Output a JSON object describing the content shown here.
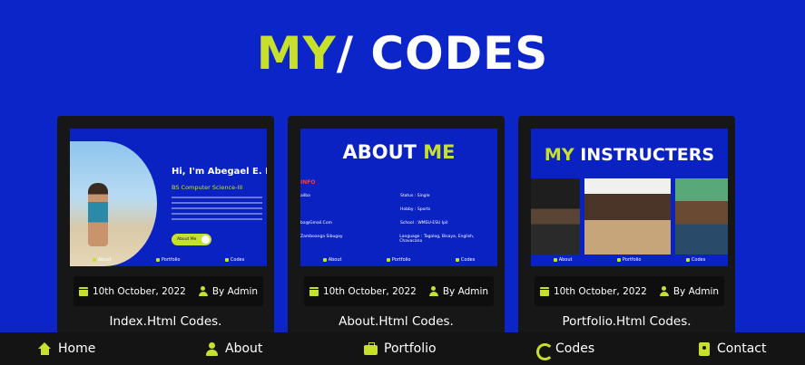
{
  "heading": {
    "accent": "MY",
    "slash": "/",
    "rest": " CODES"
  },
  "colors": {
    "background": "#0c25c9",
    "accent": "#c6e02b",
    "card": "#171717",
    "footer": "#141414"
  },
  "cards": [
    {
      "thumbnail": {
        "title": "Hi, I'm Abegael E. B",
        "subtitle": "BS Computer Science-III",
        "button": "About Me",
        "nav": [
          "About",
          "Portfolio",
          "Codes"
        ]
      },
      "date": "10th October, 2022",
      "author": "By Admin",
      "title": "Index.Html Codes."
    },
    {
      "thumbnail": {
        "title_main": "ABOUT ",
        "title_accent": "ME",
        "info": "INFO",
        "rows": [
          [
            "ailba",
            "Status : Single"
          ],
          [
            "",
            "Hobby : Sports"
          ],
          [
            "ba@Gmail.Com",
            "School : WMSU-ESU Ipil"
          ],
          [
            "Zamboanga Sibugay",
            "Language : Tagalog, Bisaya, English, Chavacano"
          ]
        ],
        "nav": [
          "About",
          "Portfolio",
          "Codes"
        ]
      },
      "date": "10th October, 2022",
      "author": "By Admin",
      "title": "About.Html Codes."
    },
    {
      "thumbnail": {
        "title_accent": "MY",
        "title_main": " INSTRUCTERS",
        "nav": [
          "About",
          "Portfolio",
          "Codes"
        ]
      },
      "date": "10th October, 2022",
      "author": "By Admin",
      "title": "Portfolio.Html Codes."
    }
  ],
  "footer": {
    "items": [
      {
        "label": "Home",
        "icon": "home-icon"
      },
      {
        "label": "About",
        "icon": "user-icon"
      },
      {
        "label": "Portfolio",
        "icon": "briefcase-icon"
      },
      {
        "label": "Codes",
        "icon": "code-icon"
      },
      {
        "label": "Contact",
        "icon": "contact-icon"
      }
    ]
  }
}
